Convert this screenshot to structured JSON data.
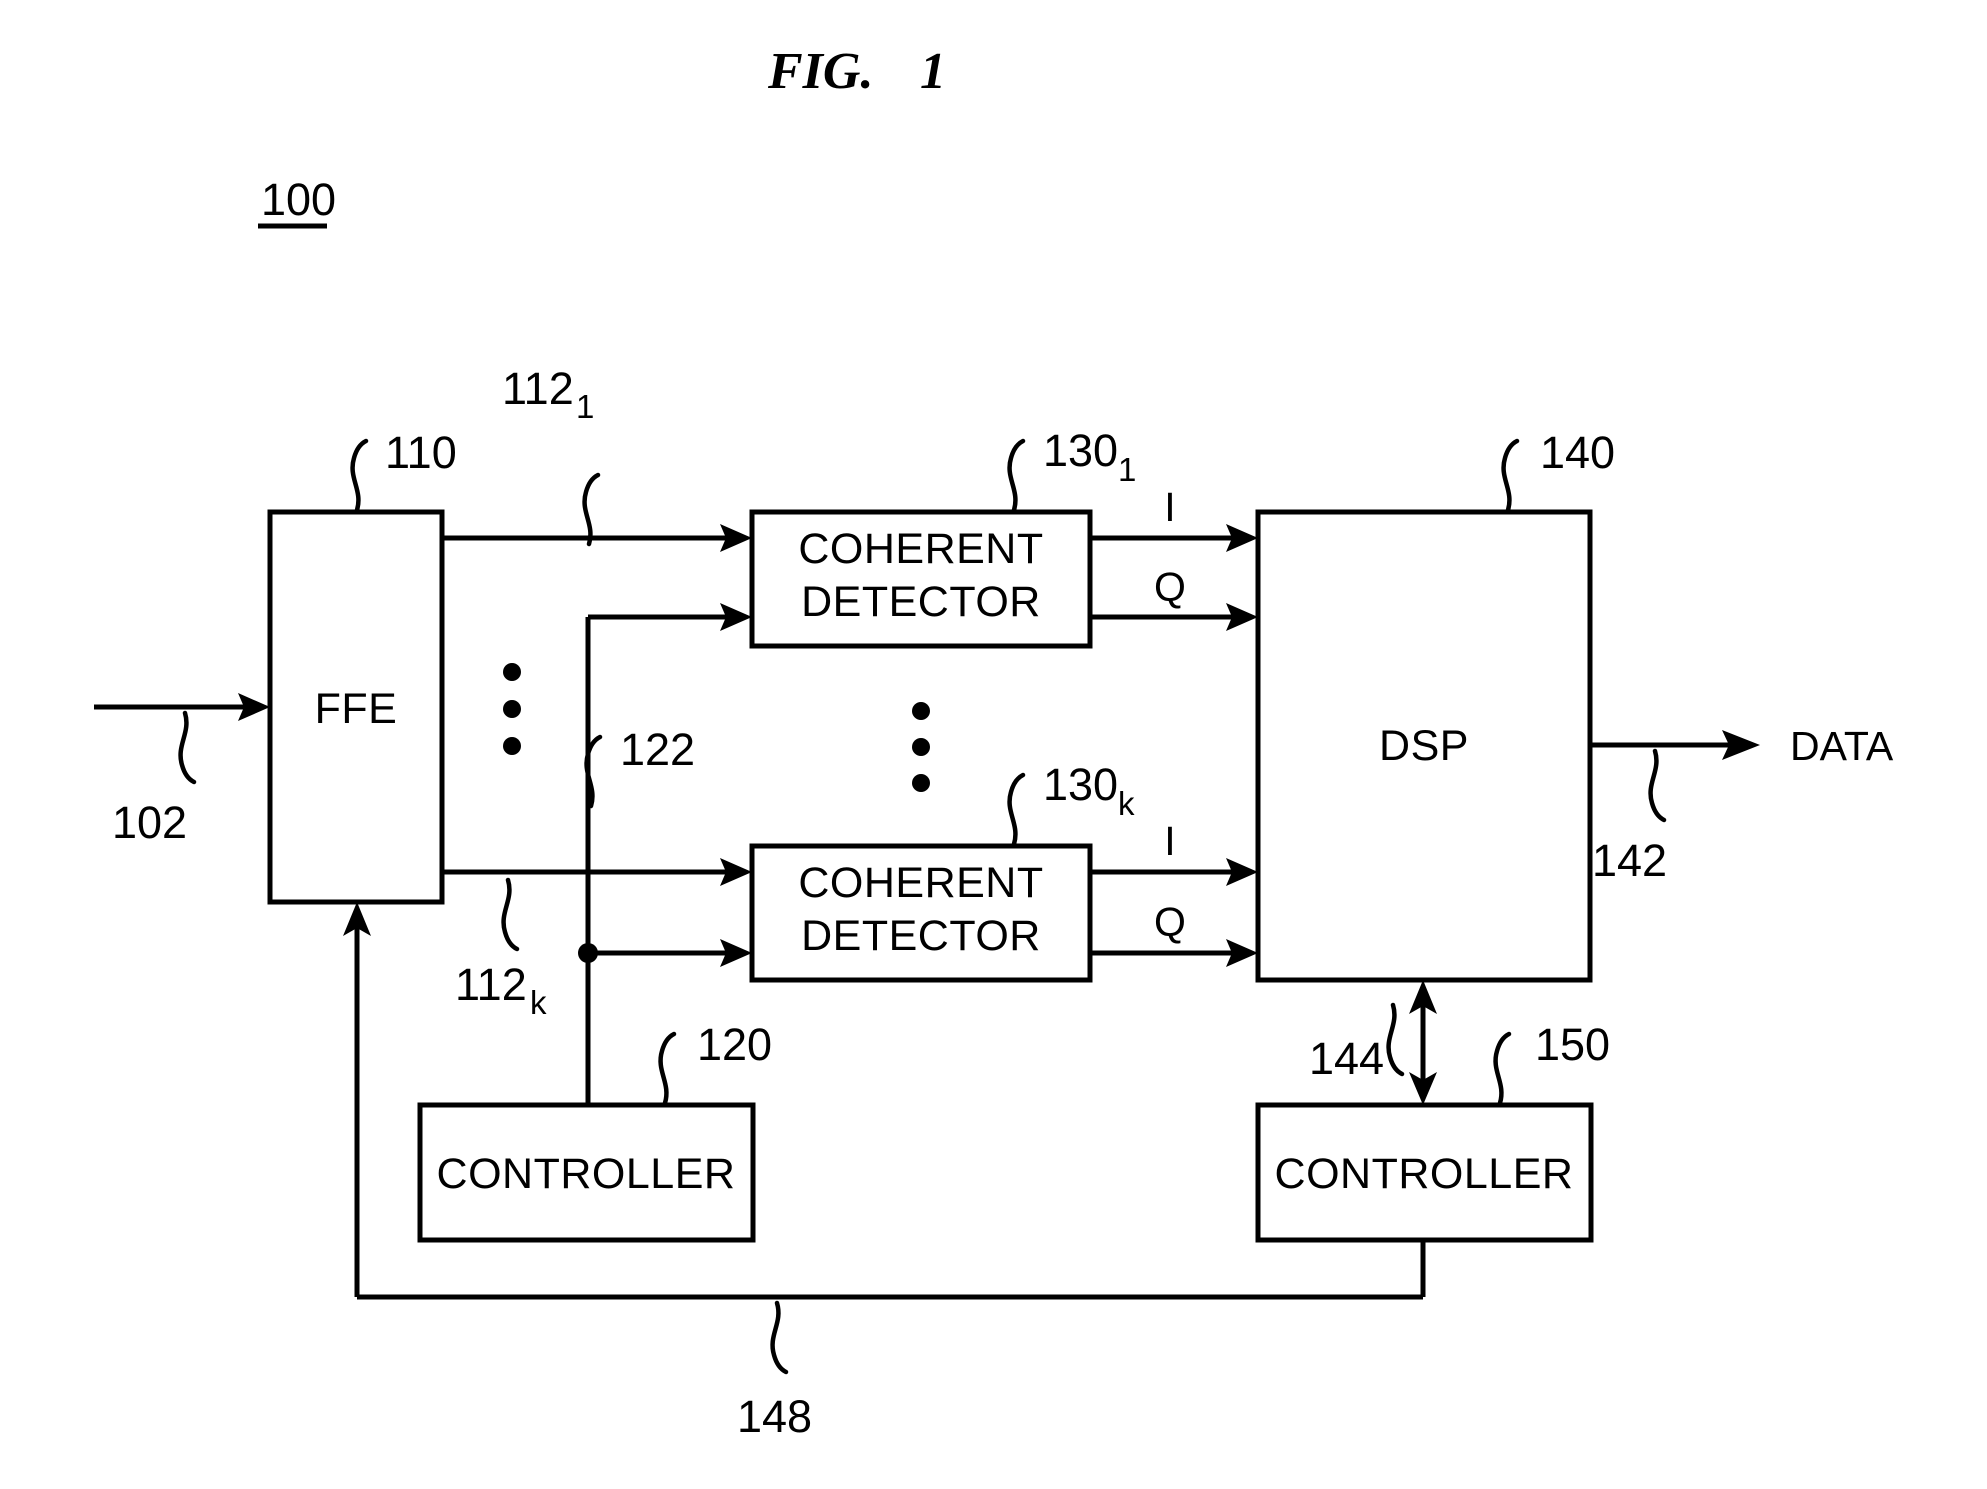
{
  "figure": {
    "title": "FIG.    1",
    "title_main": "FIG.",
    "title_number": "1",
    "system_ref": "100"
  },
  "blocks": [
    {
      "id": "ffe",
      "label": "FFE",
      "ref": "110"
    },
    {
      "id": "coherent-detector-1",
      "label_line1": "COHERENT",
      "label_line2": "DETECTOR",
      "ref": "130",
      "ref_sub": "1"
    },
    {
      "id": "coherent-detector-k",
      "label_line1": "COHERENT",
      "label_line2": "DETECTOR",
      "ref": "130",
      "ref_sub": "k"
    },
    {
      "id": "dsp",
      "label": "DSP",
      "ref": "140"
    },
    {
      "id": "controller-left",
      "label": "CONTROLLER",
      "ref": "120"
    },
    {
      "id": "controller-right",
      "label": "CONTROLLER",
      "ref": "150"
    }
  ],
  "signals": {
    "input_ref": "102",
    "ffe_out_1_ref": "112",
    "ffe_out_1_sub": "1",
    "ffe_out_k_ref": "112",
    "ffe_out_k_sub": "k",
    "controller_bus_ref": "122",
    "i_label_top": "I",
    "q_label_top": "Q",
    "i_label_bottom": "I",
    "q_label_bottom": "Q",
    "data_label": "DATA",
    "data_ref": "142",
    "dsp_controller_ref": "144",
    "feedback_ref": "148"
  },
  "ellipsis": {
    "glyph": "•",
    "ffe_outputs": "vertical-dots",
    "detectors": "vertical-dots"
  },
  "colors": {
    "line": "#000000",
    "background": "#ffffff",
    "text": "#000000"
  }
}
